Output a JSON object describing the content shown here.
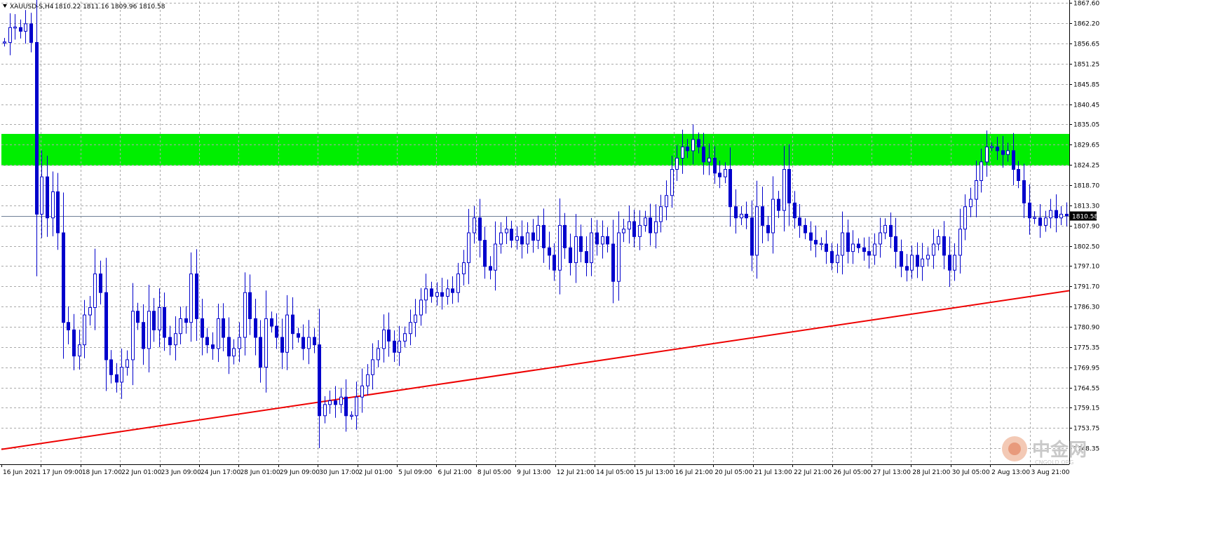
{
  "header": {
    "symbol": "XAUUSD-S,H4",
    "quote": "1810.22 1811.16 1809.96 1810.58"
  },
  "price_box": "1810.58",
  "watermark": {
    "cn": "中金网",
    "en": "CNGOLD.ORG"
  },
  "colors": {
    "candle": "#0000cc",
    "zone": "#00ee00",
    "trendline": "#ee0000",
    "grid": "#a9a9a9",
    "current_line": "#6f7f96"
  },
  "chart_data": {
    "type": "candlestick",
    "ylim": [
      1744.0,
      1868.0
    ],
    "y_ticks": [
      "1867.60",
      "1862.20",
      "1856.65",
      "1851.25",
      "1845.85",
      "1840.45",
      "1835.05",
      "1829.65",
      "1824.25",
      "1818.70",
      "1813.30",
      "1807.90",
      "1802.50",
      "1797.10",
      "1791.70",
      "1786.30",
      "1780.90",
      "1775.35",
      "1769.95",
      "1764.55",
      "1759.15",
      "1753.75",
      "1748.35"
    ],
    "x_ticks": [
      "16 Jun 2021",
      "17 Jun 09:00",
      "18 Jun 17:00",
      "22 Jun 01:00",
      "23 Jun 09:00",
      "24 Jun 17:00",
      "28 Jun 01:00",
      "29 Jun 09:00",
      "30 Jun 17:00",
      "2 Jul 01:00",
      "5 Jul 09:00",
      "6 Jul 21:00",
      "8 Jul 05:00",
      "9 Jul 13:00",
      "12 Jul 21:00",
      "14 Jul 05:00",
      "15 Jul 13:00",
      "16 Jul 21:00",
      "20 Jul 05:00",
      "21 Jul 13:00",
      "22 Jul 21:00",
      "26 Jul 05:00",
      "27 Jul 13:00",
      "28 Jul 21:00",
      "30 Jul 05:00",
      "2 Aug 13:00",
      "3 Aug 21:00"
    ],
    "current_price": 1810.58,
    "resistance_zone": [
      1824.0,
      1832.5
    ],
    "trendline": {
      "start": 1748.0,
      "end": 1790.5
    },
    "close_path": [
      [
        0,
        1857
      ],
      [
        1,
        1861
      ],
      [
        2,
        1861
      ],
      [
        3,
        1860
      ],
      [
        4,
        1862
      ],
      [
        5,
        1857
      ],
      [
        6,
        1811
      ],
      [
        7,
        1821
      ],
      [
        8,
        1810
      ],
      [
        9,
        1817
      ],
      [
        10,
        1806
      ],
      [
        11,
        1782
      ],
      [
        12,
        1780
      ],
      [
        13,
        1773
      ],
      [
        14,
        1776
      ],
      [
        15,
        1784
      ],
      [
        16,
        1786
      ],
      [
        17,
        1795
      ],
      [
        18,
        1790
      ],
      [
        19,
        1772
      ],
      [
        20,
        1768
      ],
      [
        21,
        1766
      ],
      [
        22,
        1770
      ],
      [
        23,
        1772
      ],
      [
        24,
        1785
      ],
      [
        25,
        1782
      ],
      [
        26,
        1775
      ],
      [
        27,
        1785
      ],
      [
        28,
        1780
      ],
      [
        29,
        1786
      ],
      [
        30,
        1778
      ],
      [
        31,
        1776
      ],
      [
        32,
        1779
      ],
      [
        33,
        1783
      ],
      [
        34,
        1782
      ],
      [
        35,
        1795
      ],
      [
        36,
        1783
      ],
      [
        37,
        1778
      ],
      [
        38,
        1776
      ],
      [
        39,
        1775
      ],
      [
        40,
        1783
      ],
      [
        41,
        1778
      ],
      [
        42,
        1773
      ],
      [
        43,
        1775
      ],
      [
        44,
        1778
      ],
      [
        45,
        1790
      ],
      [
        46,
        1783
      ],
      [
        47,
        1778
      ],
      [
        48,
        1770
      ],
      [
        49,
        1783
      ],
      [
        50,
        1781
      ],
      [
        51,
        1778
      ],
      [
        52,
        1774
      ],
      [
        53,
        1784
      ],
      [
        54,
        1779
      ],
      [
        55,
        1778
      ],
      [
        56,
        1775
      ],
      [
        57,
        1778
      ],
      [
        58,
        1776
      ],
      [
        59,
        1757
      ],
      [
        60,
        1760
      ],
      [
        61,
        1761
      ],
      [
        62,
        1760
      ],
      [
        63,
        1762
      ],
      [
        64,
        1757
      ],
      [
        65,
        1757
      ],
      [
        66,
        1762
      ],
      [
        67,
        1765
      ],
      [
        68,
        1768
      ],
      [
        69,
        1772
      ],
      [
        70,
        1775
      ],
      [
        71,
        1780
      ],
      [
        72,
        1777
      ],
      [
        73,
        1774
      ],
      [
        74,
        1777
      ],
      [
        75,
        1779
      ],
      [
        76,
        1782
      ],
      [
        77,
        1784
      ],
      [
        78,
        1788
      ],
      [
        79,
        1791
      ],
      [
        80,
        1789
      ],
      [
        81,
        1790
      ],
      [
        82,
        1789
      ],
      [
        83,
        1791
      ],
      [
        84,
        1790
      ],
      [
        85,
        1795
      ],
      [
        86,
        1798
      ],
      [
        87,
        1806
      ],
      [
        88,
        1810
      ],
      [
        89,
        1804
      ],
      [
        90,
        1797
      ],
      [
        91,
        1796
      ],
      [
        92,
        1803
      ],
      [
        93,
        1806
      ],
      [
        94,
        1807
      ],
      [
        95,
        1804
      ],
      [
        96,
        1805
      ],
      [
        97,
        1803
      ],
      [
        98,
        1806
      ],
      [
        99,
        1804
      ],
      [
        100,
        1808
      ],
      [
        101,
        1802
      ],
      [
        102,
        1800
      ],
      [
        103,
        1796
      ],
      [
        104,
        1808
      ],
      [
        105,
        1802
      ],
      [
        106,
        1798
      ],
      [
        107,
        1805
      ],
      [
        108,
        1801
      ],
      [
        109,
        1798
      ],
      [
        110,
        1806
      ],
      [
        111,
        1803
      ],
      [
        112,
        1805
      ],
      [
        113,
        1803
      ],
      [
        114,
        1793
      ],
      [
        115,
        1806
      ],
      [
        116,
        1807
      ],
      [
        117,
        1809
      ],
      [
        118,
        1805
      ],
      [
        119,
        1808
      ],
      [
        120,
        1810
      ],
      [
        121,
        1806
      ],
      [
        122,
        1809
      ],
      [
        123,
        1813
      ],
      [
        124,
        1816
      ],
      [
        125,
        1823
      ],
      [
        126,
        1826
      ],
      [
        127,
        1829
      ],
      [
        128,
        1828
      ],
      [
        129,
        1831
      ],
      [
        130,
        1829
      ],
      [
        131,
        1825
      ],
      [
        132,
        1826
      ],
      [
        133,
        1822
      ],
      [
        134,
        1821
      ],
      [
        135,
        1823
      ],
      [
        136,
        1813
      ],
      [
        137,
        1810
      ],
      [
        138,
        1811
      ],
      [
        139,
        1810
      ],
      [
        140,
        1800
      ],
      [
        141,
        1813
      ],
      [
        142,
        1808
      ],
      [
        143,
        1806
      ],
      [
        144,
        1815
      ],
      [
        145,
        1812
      ],
      [
        146,
        1823
      ],
      [
        147,
        1814
      ],
      [
        148,
        1810
      ],
      [
        149,
        1808
      ],
      [
        150,
        1806
      ],
      [
        151,
        1804
      ],
      [
        152,
        1803
      ],
      [
        153,
        1803
      ],
      [
        154,
        1801
      ],
      [
        155,
        1798
      ],
      [
        156,
        1800
      ],
      [
        157,
        1806
      ],
      [
        158,
        1801
      ],
      [
        159,
        1803
      ],
      [
        160,
        1802
      ],
      [
        161,
        1801
      ],
      [
        162,
        1800
      ],
      [
        163,
        1803
      ],
      [
        164,
        1806
      ],
      [
        165,
        1808
      ],
      [
        166,
        1805
      ],
      [
        167,
        1801
      ],
      [
        168,
        1797
      ],
      [
        169,
        1796
      ],
      [
        170,
        1800
      ],
      [
        171,
        1797
      ],
      [
        172,
        1799
      ],
      [
        173,
        1800
      ],
      [
        174,
        1803
      ],
      [
        175,
        1805
      ],
      [
        176,
        1800
      ],
      [
        177,
        1796
      ],
      [
        178,
        1800
      ],
      [
        179,
        1807
      ],
      [
        180,
        1813
      ],
      [
        181,
        1815
      ],
      [
        182,
        1820
      ],
      [
        183,
        1825
      ],
      [
        184,
        1829
      ],
      [
        185,
        1829
      ],
      [
        186,
        1828
      ],
      [
        187,
        1827
      ],
      [
        188,
        1828
      ],
      [
        189,
        1823
      ],
      [
        190,
        1820
      ],
      [
        191,
        1814
      ],
      [
        192,
        1810
      ],
      [
        193,
        1810
      ],
      [
        194,
        1808
      ],
      [
        195,
        1810
      ],
      [
        196,
        1812
      ],
      [
        197,
        1810
      ],
      [
        198,
        1811
      ],
      [
        199,
        1810.58
      ]
    ]
  }
}
